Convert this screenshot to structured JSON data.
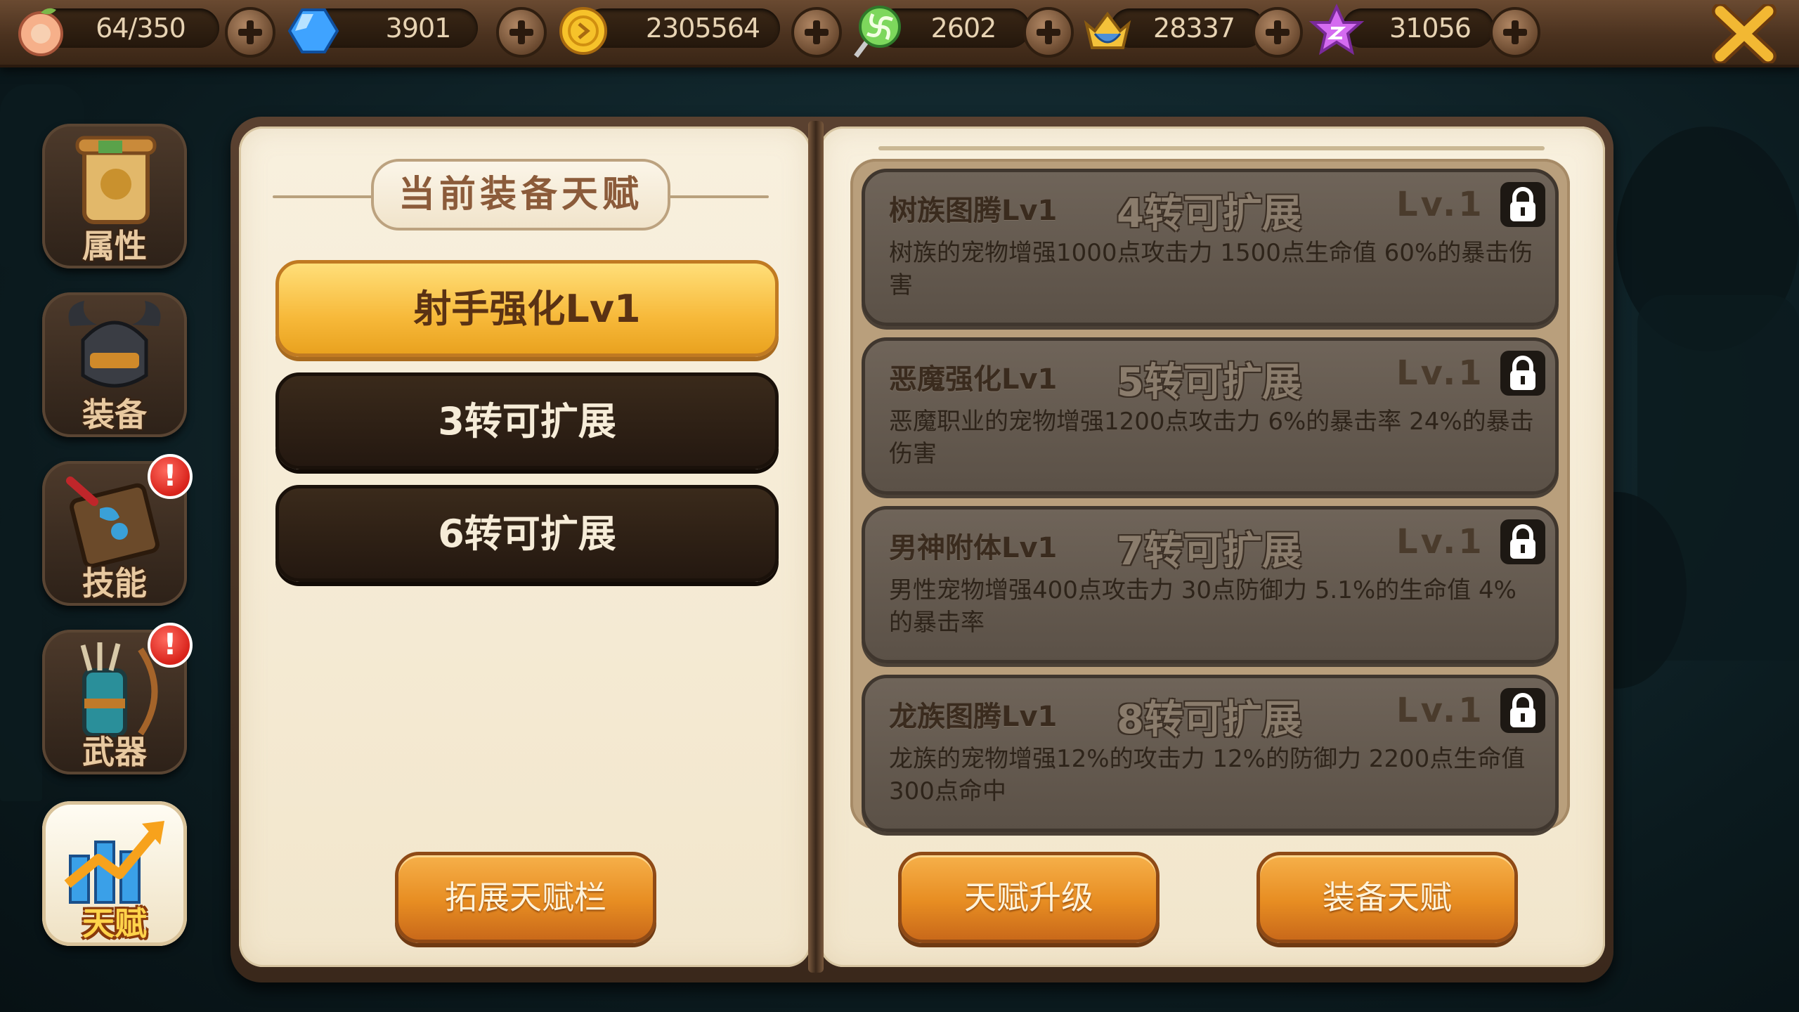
{
  "resources": [
    {
      "icon": "peach-stamina-icon",
      "value": "64/350"
    },
    {
      "icon": "blue-crystal-icon",
      "value": "3901"
    },
    {
      "icon": "gold-coin-icon",
      "value": "2305564"
    },
    {
      "icon": "lollipop-candy-icon",
      "value": "2602"
    },
    {
      "icon": "crown-badge-icon",
      "value": "28337"
    },
    {
      "icon": "purple-star-icon",
      "value": "31056"
    }
  ],
  "nav": [
    {
      "label": "属性",
      "icon": "scroll-icon",
      "alert": false
    },
    {
      "label": "装备",
      "icon": "horned-helmet-icon",
      "alert": false
    },
    {
      "label": "技能",
      "icon": "skill-book-icon",
      "alert": true
    },
    {
      "label": "武器",
      "icon": "quiver-bow-icon",
      "alert": true
    },
    {
      "label": "天赋",
      "icon": "growth-chart-icon",
      "alert": false,
      "active": true
    }
  ],
  "alert_mark": "!",
  "left_page": {
    "title": "当前装备天赋",
    "slots": [
      {
        "label": "射手强化Lv1",
        "state": "equipped"
      },
      {
        "label": "3转可扩展",
        "state": "locked"
      },
      {
        "label": "6转可扩展",
        "state": "locked"
      }
    ],
    "expand_button": "拓展天赋栏"
  },
  "talents": [
    {
      "name": "树族图腾Lv1",
      "requirement": "4转可扩展",
      "level": "Lv.1",
      "desc": "树族的宠物增强1000点攻击力  1500点生命值  60%的暴击伤害"
    },
    {
      "name": "恶魔强化Lv1",
      "requirement": "5转可扩展",
      "level": "Lv.1",
      "desc": "恶魔职业的宠物增强1200点攻击力  6%的暴击率  24%的暴击伤害"
    },
    {
      "name": "男神附体Lv1",
      "requirement": "7转可扩展",
      "level": "Lv.1",
      "desc": "男性宠物增强400点攻击力  30点防御力  5.1%的生命值  4%的暴击率"
    },
    {
      "name": "龙族图腾Lv1",
      "requirement": "8转可扩展",
      "level": "Lv.1",
      "desc": "龙族的宠物增强12%的攻击力  12%的防御力  2200点生命值  300点命中"
    }
  ],
  "buttons": {
    "upgrade": "天赋升级",
    "equip": "装备天赋"
  },
  "colors": {
    "accent_orange": "#e78d22",
    "equipped_gold": "#f7b93a",
    "locked_dark": "#241810",
    "alert_red": "#d8231b"
  }
}
